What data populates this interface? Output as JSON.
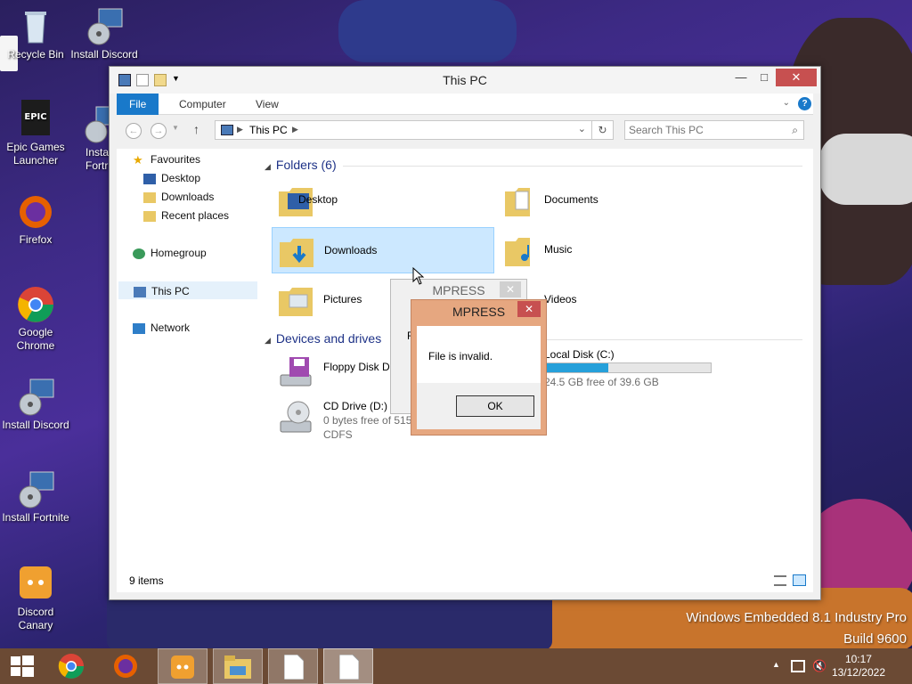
{
  "desktop": {
    "icons": [
      {
        "label": "Recycle Bin",
        "icon": "recycle-bin-icon"
      },
      {
        "label": "Install Discord",
        "icon": "installer-icon"
      },
      {
        "label": "Epic Games Launcher",
        "icon": "epic-games-icon"
      },
      {
        "label": "Insta Fortr",
        "icon": "installer-icon"
      },
      {
        "label": "Firefox",
        "icon": "firefox-icon"
      },
      {
        "label": "Google Chrome",
        "icon": "chrome-icon"
      },
      {
        "label": "Install Discord",
        "icon": "installer-icon"
      },
      {
        "label": "Install Fortnite",
        "icon": "installer-icon"
      },
      {
        "label": "Discord Canary",
        "icon": "discord-icon"
      }
    ],
    "watermark": {
      "line1": "Windows Embedded 8.1 Industry Pro",
      "line2": "Build 9600"
    }
  },
  "explorer": {
    "title": "This PC",
    "ribbon_tabs": [
      "File",
      "Computer",
      "View"
    ],
    "address": "This PC",
    "search_placeholder": "Search This PC",
    "nav": {
      "favourites": "Favourites",
      "desktop": "Desktop",
      "downloads": "Downloads",
      "recent": "Recent places",
      "homegroup": "Homegroup",
      "thispc": "This PC",
      "network": "Network"
    },
    "folders_header": "Folders (6)",
    "folders": [
      {
        "label": "Desktop"
      },
      {
        "label": "Documents"
      },
      {
        "label": "Downloads"
      },
      {
        "label": "Music"
      },
      {
        "label": "Pictures"
      },
      {
        "label": "Videos"
      }
    ],
    "devices_header": "Devices and drives",
    "drives": [
      {
        "name": "Floppy Disk Dr"
      },
      {
        "name": "Local Disk (C:)",
        "free": "24.5 GB free of 39.6 GB",
        "used_fraction": 0.38
      },
      {
        "name": "CD Drive (D:) v",
        "free": "0 bytes free of 515",
        "fs": "CDFS"
      }
    ],
    "status": "9 items"
  },
  "dialog_back": {
    "title": "MPRESS",
    "partial_letter": "F"
  },
  "dialog": {
    "title": "MPRESS",
    "message": "File is invalid.",
    "ok": "OK",
    "close": "✕"
  },
  "taskbar": {
    "time": "10:17",
    "date": "13/12/2022"
  },
  "colors": {
    "accent": "#1979ca",
    "dialog_frame": "#e6a780",
    "close_red": "#c75050",
    "taskbar": "#6b4a34"
  }
}
